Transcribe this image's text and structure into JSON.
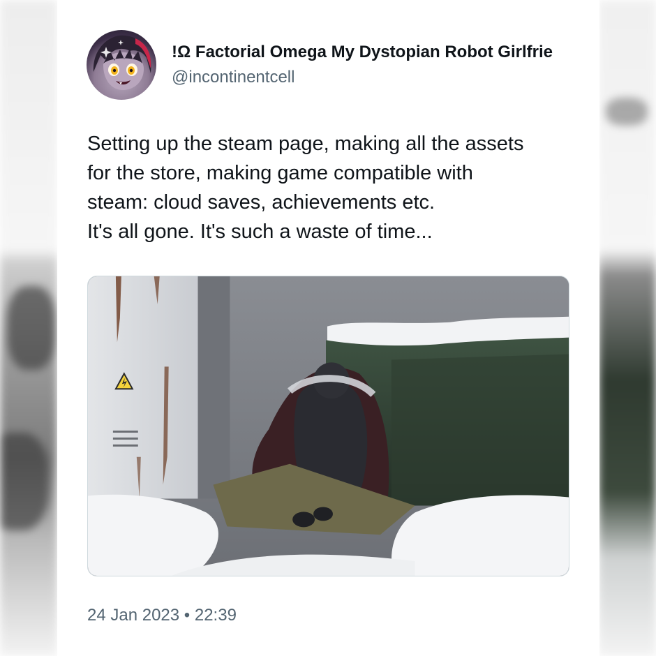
{
  "tweet": {
    "author": {
      "display_name": "!Ω Factorial Omega My Dystopian Robot Girlfrie",
      "handle": "@incontinentcell",
      "avatar_icon": "avatar-image"
    },
    "text_lines": [
      "Setting up the steam page, making all the assets",
      "for the store, making game compatible with",
      "steam: cloud saves, achievements etc.",
      "It's all gone. It's such a waste of time..."
    ],
    "media": {
      "kind": "illustration-image"
    },
    "timestamp": "24 Jan 2023 • 22:39"
  },
  "colors": {
    "text_primary": "#0f1419",
    "text_secondary": "#536471",
    "border": "#cfd9de"
  }
}
